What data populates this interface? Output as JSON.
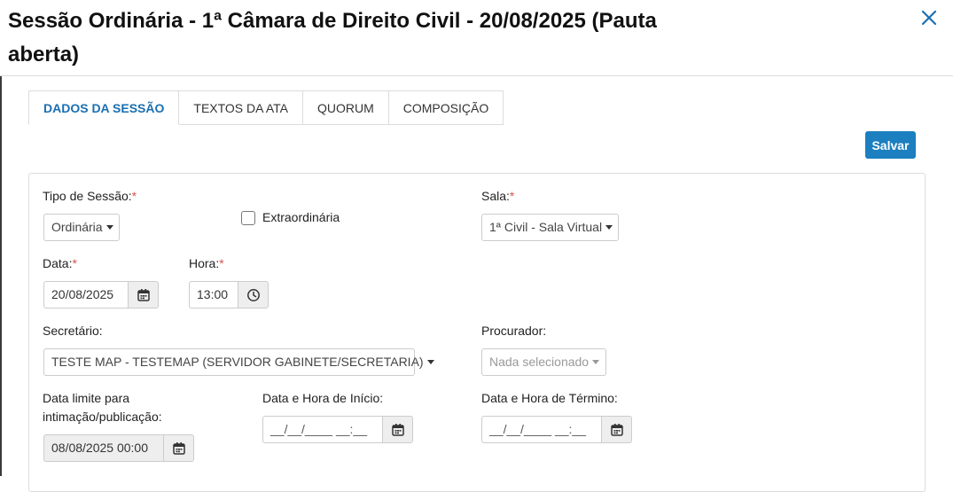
{
  "modal": {
    "title": "Sessão Ordinária - 1ª Câmara de Direito Civil - 20/08/2025 (Pauta aberta)"
  },
  "tabs": [
    {
      "label": "DADOS DA SESSÃO",
      "active": true
    },
    {
      "label": "TEXTOS DA ATA",
      "active": false
    },
    {
      "label": "QUORUM",
      "active": false
    },
    {
      "label": "COMPOSIÇÃO",
      "active": false
    }
  ],
  "toolbar": {
    "save_label": "Salvar"
  },
  "form": {
    "tipo_sessao": {
      "label": "Tipo de Sessão:",
      "required": "*",
      "value": "Ordinária"
    },
    "extraordinaria": {
      "label": "Extraordinária",
      "checked": false
    },
    "sala": {
      "label": "Sala:",
      "required": "*",
      "value": "1ª Civil - Sala Virtual"
    },
    "data": {
      "label": "Data:",
      "required": "*",
      "value": "20/08/2025"
    },
    "hora": {
      "label": "Hora:",
      "required": "*",
      "value": "13:00"
    },
    "secretario": {
      "label": "Secretário:",
      "value": "TESTE MAP - TESTEMAP (SERVIDOR GABINETE/SECRETARIA)"
    },
    "procurador": {
      "label": "Procurador:",
      "value": "Nada selecionado"
    },
    "data_limite": {
      "label_line1": "Data limite para",
      "label_line2": "intimação/publicação:",
      "value": "08/08/2025 00:00"
    },
    "inicio": {
      "label": "Data e Hora de Início:",
      "placeholder": "__/__/____ __:__"
    },
    "termino": {
      "label": "Data e Hora de Término:",
      "placeholder": "__/__/____ __:__"
    }
  },
  "icons": {
    "close": "close-icon",
    "calendar": "calendar-icon",
    "clock": "clock-icon"
  },
  "colors": {
    "accent": "#1c7fbf",
    "active_tab": "#1a6fb0",
    "close": "#1a6fb0",
    "required": "#d9534f"
  }
}
